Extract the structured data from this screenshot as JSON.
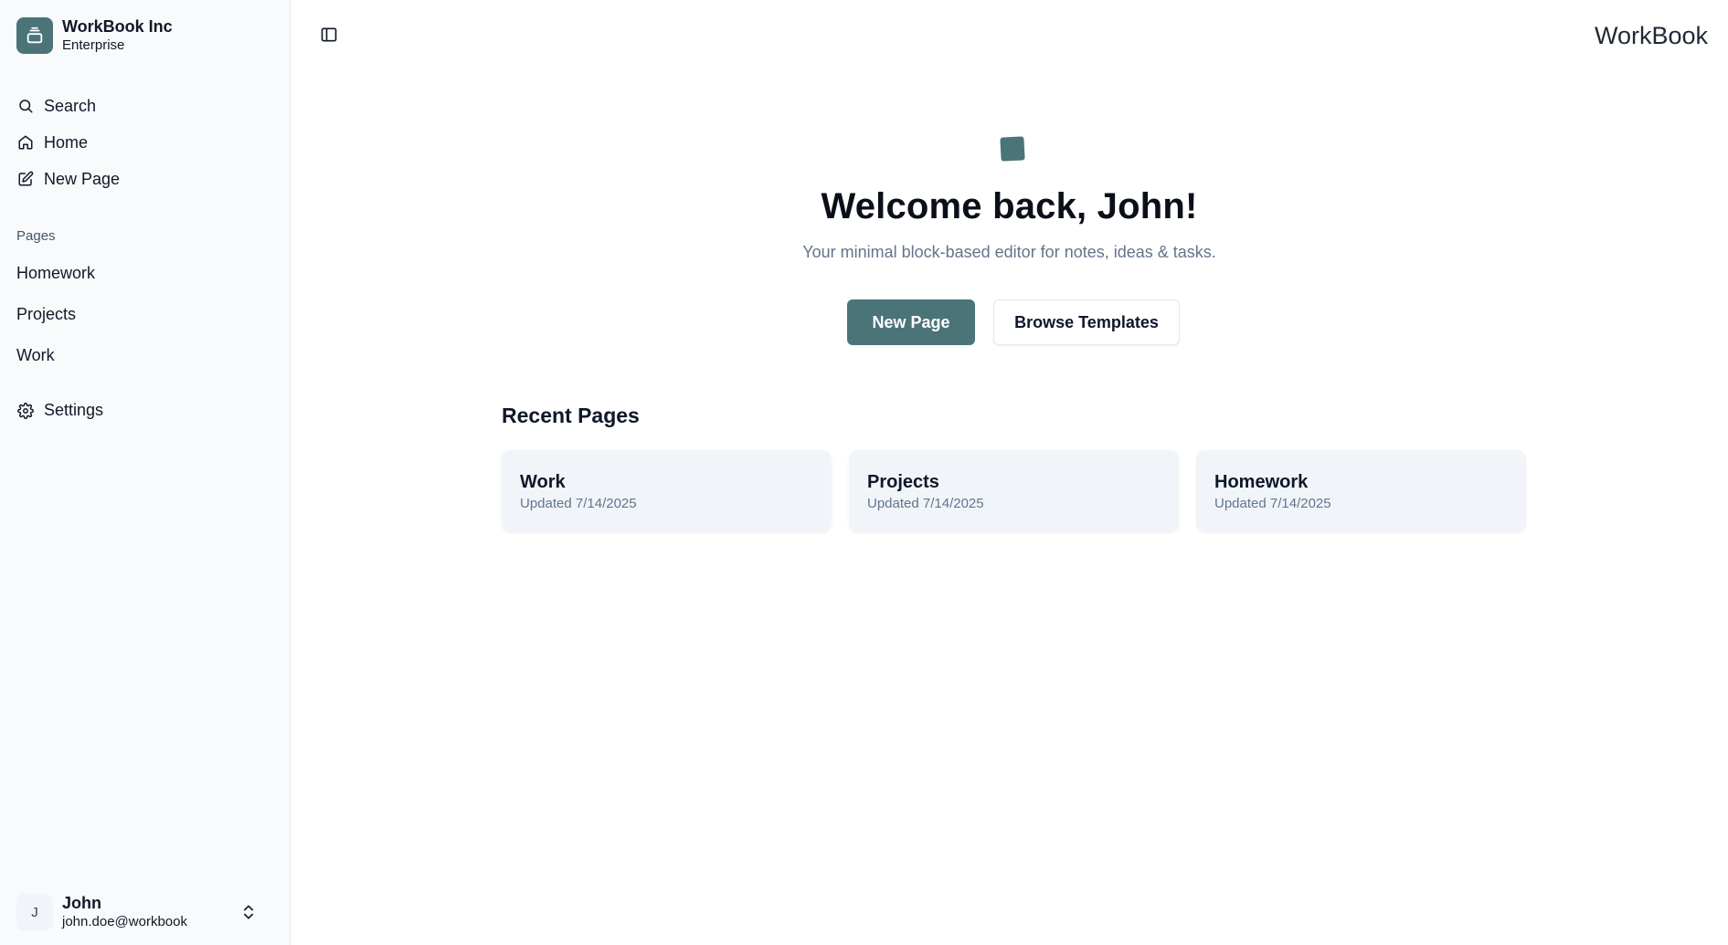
{
  "sidebar": {
    "brand": {
      "name": "WorkBook Inc",
      "plan": "Enterprise",
      "logo_icon": "stack-icon"
    },
    "nav": [
      {
        "label": "Search",
        "icon": "search-icon"
      },
      {
        "label": "Home",
        "icon": "home-icon"
      },
      {
        "label": "New Page",
        "icon": "edit-icon"
      }
    ],
    "pages_label": "Pages",
    "pages": [
      "Homework",
      "Projects",
      "Work"
    ],
    "settings": {
      "label": "Settings",
      "icon": "gear-icon"
    },
    "user": {
      "initial": "J",
      "name": "John",
      "email": "john.doe@workbook",
      "chevron_icon": "chevron-up-down-icon"
    }
  },
  "header": {
    "app_name": "WorkBook",
    "toggle_icon": "sidebar-toggle-icon"
  },
  "hero": {
    "title": "Welcome back, John!",
    "subtitle": "Your minimal block-based editor for notes, ideas & tasks.",
    "primary_button": "New Page",
    "secondary_button": "Browse Templates"
  },
  "recent": {
    "title": "Recent Pages",
    "cards": [
      {
        "title": "Work",
        "updated": "Updated 7/14/2025"
      },
      {
        "title": "Projects",
        "updated": "Updated 7/14/2025"
      },
      {
        "title": "Homework",
        "updated": "Updated 7/14/2025"
      }
    ]
  },
  "colors": {
    "accent": "#4b7479",
    "sidebar_bg": "#f8fafc",
    "card_bg": "#f1f5f9",
    "muted_text": "#64748b"
  }
}
